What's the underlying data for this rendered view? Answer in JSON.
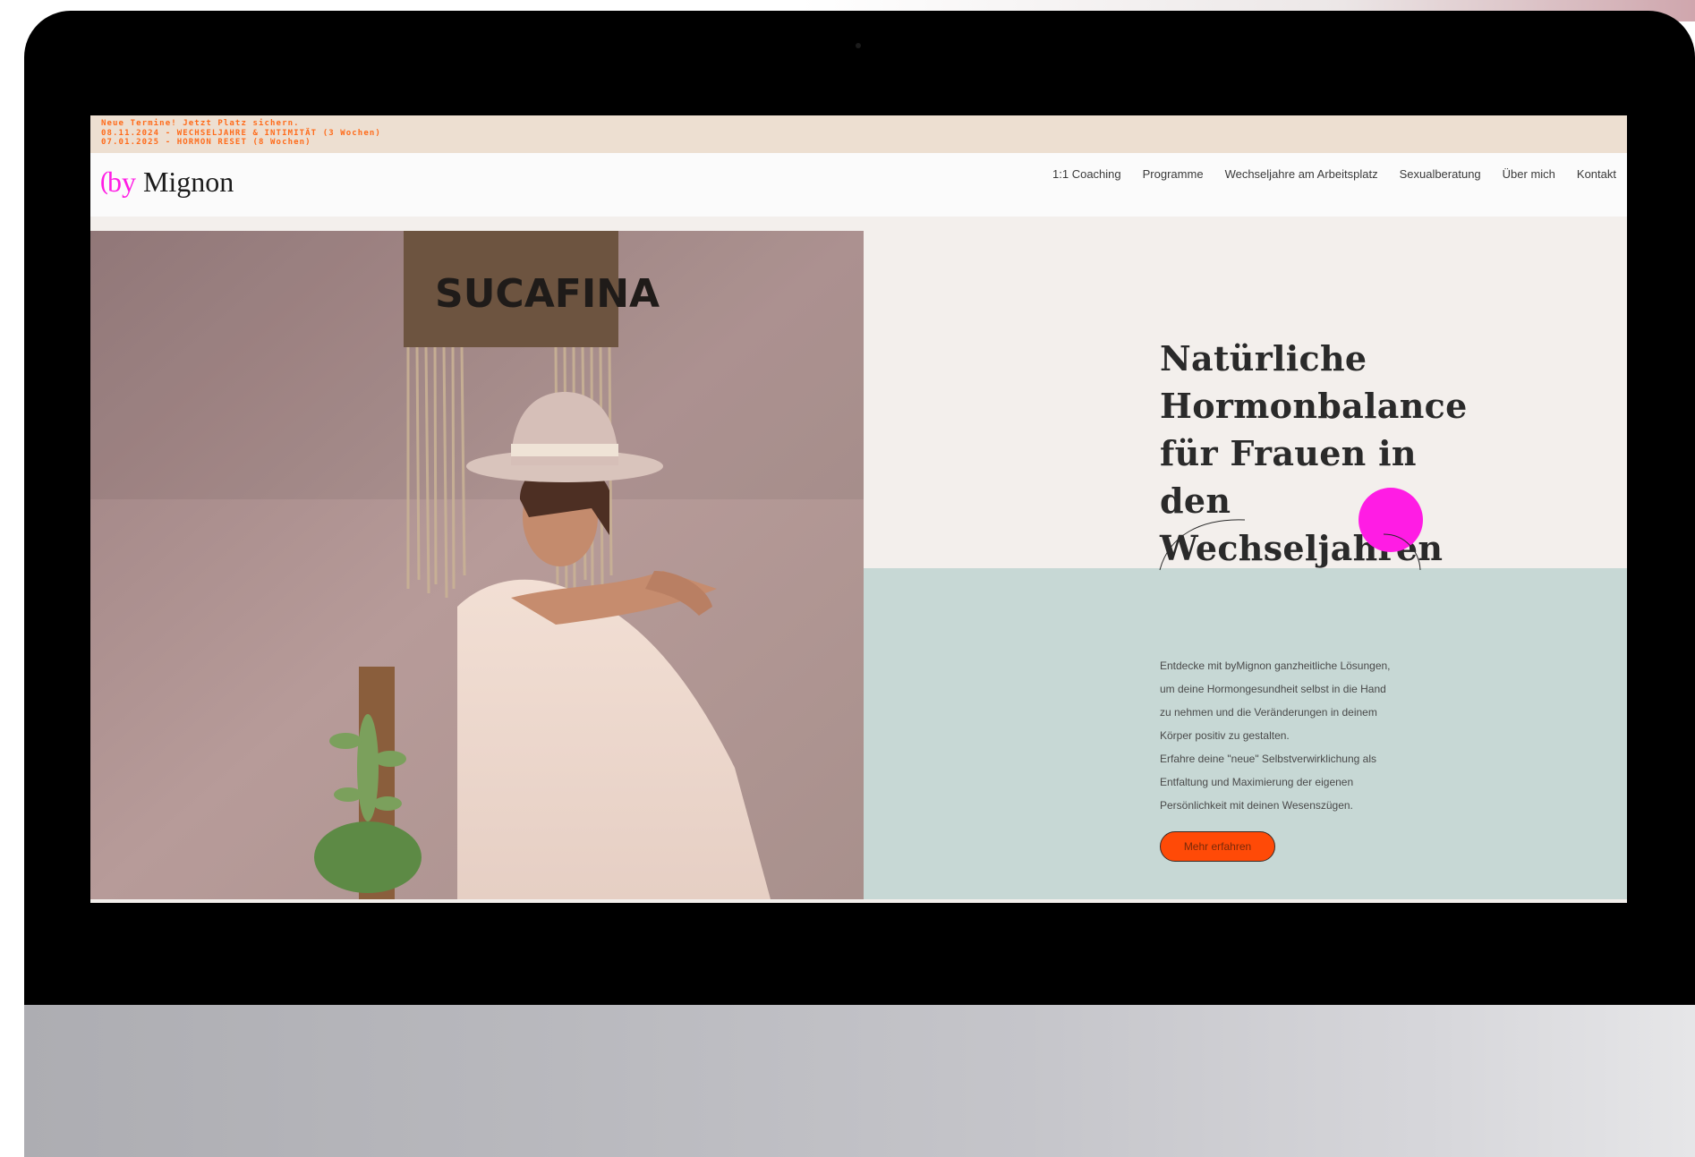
{
  "announcement": {
    "lines": [
      "Neue Termine! Jetzt Platz sichern.",
      "08.11.2024 - WECHSELJAHRE & INTIMITÄT (3 Wochen)",
      "07.01.2025 - HORMON RESET (8 Wochen)"
    ]
  },
  "brand": {
    "mark": "(",
    "by": "by",
    "name": "Mignon"
  },
  "nav": {
    "items": [
      "1:1 Coaching",
      "Programme",
      "Wechseljahre am Arbeitsplatz",
      "Sexualberatung",
      "Über mich",
      "Kontakt"
    ]
  },
  "hero": {
    "photo_banner_text": "SUCAFINA",
    "headline": "Natürliche\nHormonbalance\nfür Frauen in den\nWechseljahren",
    "description": "Entdecke mit byMignon ganzheitliche Lösungen,\num deine Hormongesundheit selbst in die Hand\nzu nehmen und die Veränderungen in deinem\nKörper positiv zu gestalten.\nErfahre deine \"neue\" Selbstverwirklichung als\nEntfaltung und Maximierung der eigenen\nPersönlichkeit mit deinen Wesenszügen.",
    "cta_label": "Mehr erfahren"
  },
  "colors": {
    "accent_magenta": "#ff1ce4",
    "cta_orange": "#ff4a07",
    "announce_text": "#ff6b1a",
    "announce_bg": "#eddfd1",
    "mint_panel": "#c7d8d5"
  }
}
